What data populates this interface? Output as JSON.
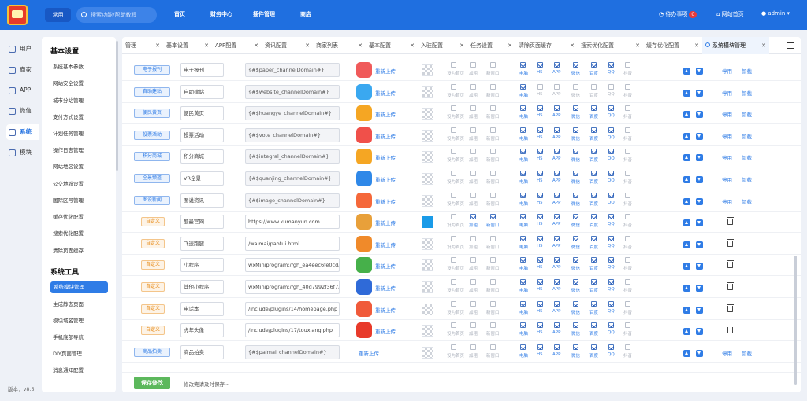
{
  "header": {
    "home_btn": "常用",
    "search_placeholder": "搜索功能/帮助教程",
    "nav": [
      "首页",
      "财务中心",
      "插件管理",
      "商店"
    ],
    "todo": "待办事项",
    "todo_count": "0",
    "site_home": "网站首页",
    "user": "admin"
  },
  "rail": [
    "用户",
    "商家",
    "APP",
    "微信",
    "系统",
    "模块"
  ],
  "version": "版本：v8.5",
  "submenu": {
    "sec1": "基本设置",
    "items1": [
      "系统基本参数",
      "网站安全设置",
      "城市分站管理",
      "支付方式设置",
      "计划任务管理",
      "操作日志管理",
      "网站地区设置",
      "公交地铁设置",
      "国际区号管理",
      "缓存优化配置",
      "搜索优化配置",
      "清除页面缓存"
    ],
    "sec2": "系统工具",
    "items2": [
      "系统模块管理",
      "生成静态页面",
      "模块域名管理",
      "手机底部导航",
      "DIY页面管理",
      "消息通知配置"
    ]
  },
  "tabs": [
    "管理",
    "基本设置",
    "APP配置",
    "资讯配置",
    "商家列表",
    "基本配置",
    "入驻配置",
    "任务设置",
    "清除页面缓存",
    "搜索优化配置",
    "缓存优化配置",
    "系统模块管理"
  ],
  "labels": {
    "home": "设为首页",
    "bold": "加粗",
    "newwin": "新窗口",
    "pc": "电脑",
    "h5": "H5",
    "app": "APP",
    "wx": "微信",
    "bd": "百度",
    "qq": "QQ",
    "dy": "抖音",
    "reupload": "重新上传",
    "disable": "停用",
    "uninstall": "卸载"
  },
  "rows": [
    {
      "tag": "电子报刊",
      "custom": false,
      "name": "电子报刊",
      "domain": "{#$paper_channelDomain#}",
      "icolor": "#f05a5a",
      "thumb": "checker",
      "cb": [
        0,
        0,
        0,
        1,
        1,
        1,
        1,
        1,
        1,
        0
      ],
      "ops": "uninstall"
    },
    {
      "tag": "自助建站",
      "custom": false,
      "name": "自助建站",
      "domain": "{#$website_channelDomain#}",
      "icolor": "#3aa8f0",
      "thumb": "checker",
      "cb": [
        0,
        0,
        0,
        1,
        0,
        0,
        0,
        0,
        0,
        0
      ],
      "ops": "uninstall"
    },
    {
      "tag": "便民黄页",
      "custom": false,
      "name": "便民黄页",
      "domain": "{#$huangye_channelDomain#}",
      "icolor": "#f5a623",
      "thumb": "checker",
      "cb": [
        0,
        0,
        0,
        1,
        1,
        1,
        1,
        1,
        1,
        0
      ],
      "ops": "uninstall"
    },
    {
      "tag": "投票活动",
      "custom": false,
      "name": "投票活动",
      "domain": "{#$vote_channelDomain#}",
      "icolor": "#f0504a",
      "thumb": "checker",
      "cb": [
        0,
        0,
        0,
        1,
        1,
        1,
        1,
        1,
        1,
        0
      ],
      "ops": "uninstall"
    },
    {
      "tag": "积分商城",
      "custom": false,
      "name": "积分商城",
      "domain": "{#$integral_channelDomain#}",
      "icolor": "#f5a623",
      "thumb": "checker",
      "cb": [
        0,
        0,
        0,
        1,
        1,
        1,
        1,
        1,
        1,
        0
      ],
      "ops": "uninstall"
    },
    {
      "tag": "全景频道",
      "custom": false,
      "name": "VR全景",
      "domain": "{#$quanjing_channelDomain#}",
      "icolor": "#2f88e8",
      "thumb": "checker",
      "cb": [
        0,
        0,
        0,
        1,
        1,
        1,
        1,
        1,
        1,
        0
      ],
      "ops": "uninstall"
    },
    {
      "tag": "图说新闻",
      "custom": false,
      "name": "图说资讯",
      "domain": "{#$image_channelDomain#}",
      "icolor": "#f5683a",
      "thumb": "checker",
      "cb": [
        0,
        0,
        0,
        1,
        1,
        1,
        1,
        1,
        1,
        0
      ],
      "ops": "uninstall"
    },
    {
      "tag": "自定义",
      "custom": true,
      "name": "酷曼官网",
      "domain": "https://www.kumanyun.com",
      "icolor": "#e8a03a",
      "thumb": "blue",
      "cb": [
        0,
        1,
        1,
        1,
        1,
        1,
        1,
        1,
        1,
        0
      ],
      "ops": "trash"
    },
    {
      "tag": "自定义",
      "custom": true,
      "name": "飞速跑腿",
      "domain": "/waimai/paotui.html",
      "icolor": "#f08a2a",
      "thumb": "checker",
      "cb": [
        0,
        0,
        0,
        1,
        1,
        1,
        1,
        1,
        1,
        0
      ],
      "ops": "trash"
    },
    {
      "tag": "自定义",
      "custom": true,
      "name": "小程序",
      "domain": "wxMiniprogram://gh_ea4eec6fe0cd/",
      "icolor": "#46b04a",
      "thumb": "checker",
      "cb": [
        0,
        0,
        0,
        1,
        1,
        1,
        1,
        1,
        1,
        0
      ],
      "ops": "trash"
    },
    {
      "tag": "自定义",
      "custom": true,
      "name": "其他小程序",
      "domain": "wxMiniprogram://gh_40d7992f36f7/",
      "icolor": "#2f6ad8",
      "thumb": "checker",
      "cb": [
        0,
        0,
        0,
        1,
        1,
        1,
        1,
        1,
        1,
        0
      ],
      "ops": "trash"
    },
    {
      "tag": "自定义",
      "custom": true,
      "name": "电话本",
      "domain": "/include/plugins/14/homepage.php",
      "icolor": "#f05a3a",
      "thumb": "checker",
      "cb": [
        0,
        0,
        0,
        1,
        1,
        1,
        1,
        1,
        1,
        0
      ],
      "ops": "trash"
    },
    {
      "tag": "自定义",
      "custom": true,
      "name": "虎年头像",
      "domain": "/include/plugins/17/touxiang.php",
      "icolor": "#e83a2a",
      "thumb": "checker",
      "cb": [
        0,
        0,
        0,
        1,
        1,
        1,
        1,
        1,
        1,
        0
      ],
      "ops": "trash"
    },
    {
      "tag": "商品拍卖",
      "custom": false,
      "name": "商品拍卖",
      "domain": "{#$paimai_channelDomain#}",
      "icolor": "",
      "thumb": "checker",
      "cb": [
        0,
        0,
        0,
        1,
        1,
        1,
        1,
        1,
        1,
        0
      ],
      "ops": "uninstall"
    }
  ],
  "footer": {
    "save": "保存修改",
    "hint": "修改完请及时保存~"
  },
  "colors": {
    "primary": "#1f6fe0",
    "accent": "#2f7ce6",
    "save": "#5cb85c",
    "tag": "#2f7ce6",
    "custom_tag": "#e88c1a"
  }
}
